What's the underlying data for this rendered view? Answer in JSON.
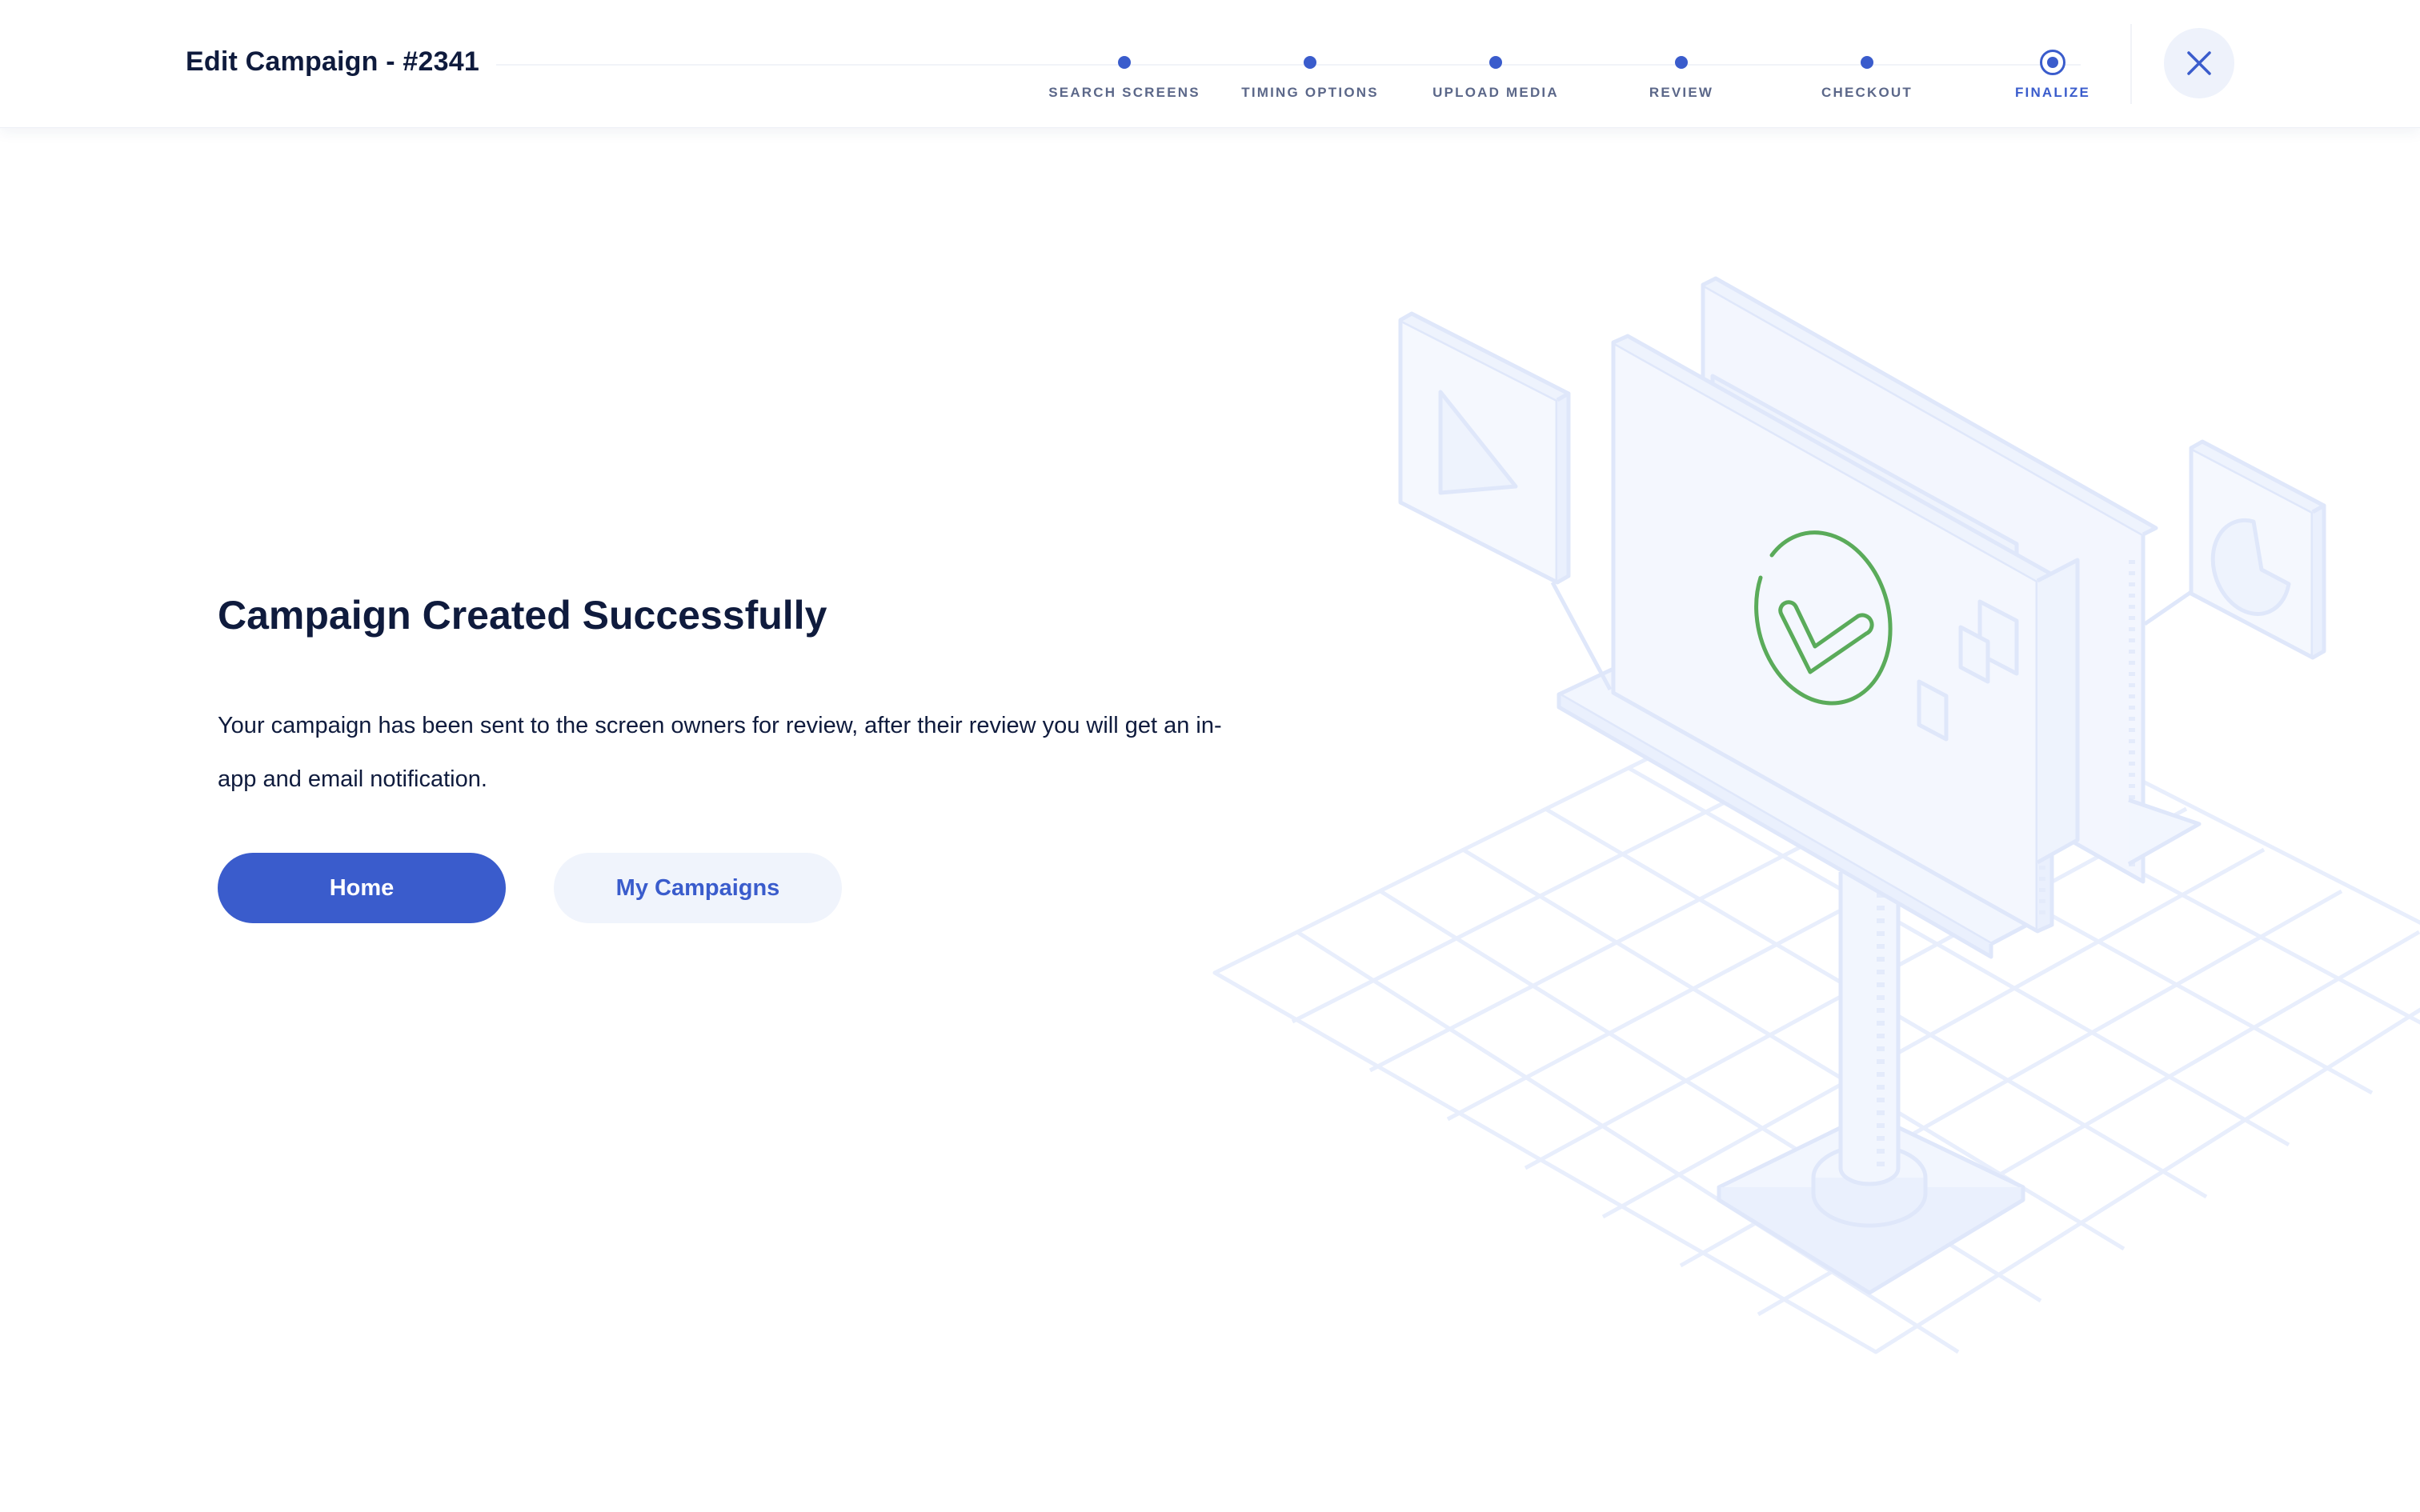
{
  "header": {
    "title": "Edit Campaign - #2341",
    "steps": [
      {
        "label": "SEARCH SCREENS",
        "state": "done"
      },
      {
        "label": "TIMING OPTIONS",
        "state": "done"
      },
      {
        "label": "UPLOAD MEDIA",
        "state": "done"
      },
      {
        "label": "REVIEW",
        "state": "done"
      },
      {
        "label": "CHECKOUT",
        "state": "done"
      },
      {
        "label": "FINALIZE",
        "state": "current"
      }
    ],
    "close_icon": "close-icon"
  },
  "main": {
    "headline": "Campaign Created Successfully",
    "body": "Your campaign has been sent to the screen owners for review, after their review you will get an in-app and email notification.",
    "buttons": {
      "home_label": "Home",
      "my_campaigns_label": "My Campaigns"
    }
  },
  "illustration": {
    "icon": "billboard-success-illustration",
    "check_color": "#5aab5a"
  },
  "colors": {
    "accent": "#3a5ccc",
    "text": "#0f1b3d",
    "muted_step_label": "#5b6789",
    "illustration_line": "#dfe7fa",
    "illustration_fill": "#f2f6fe"
  }
}
